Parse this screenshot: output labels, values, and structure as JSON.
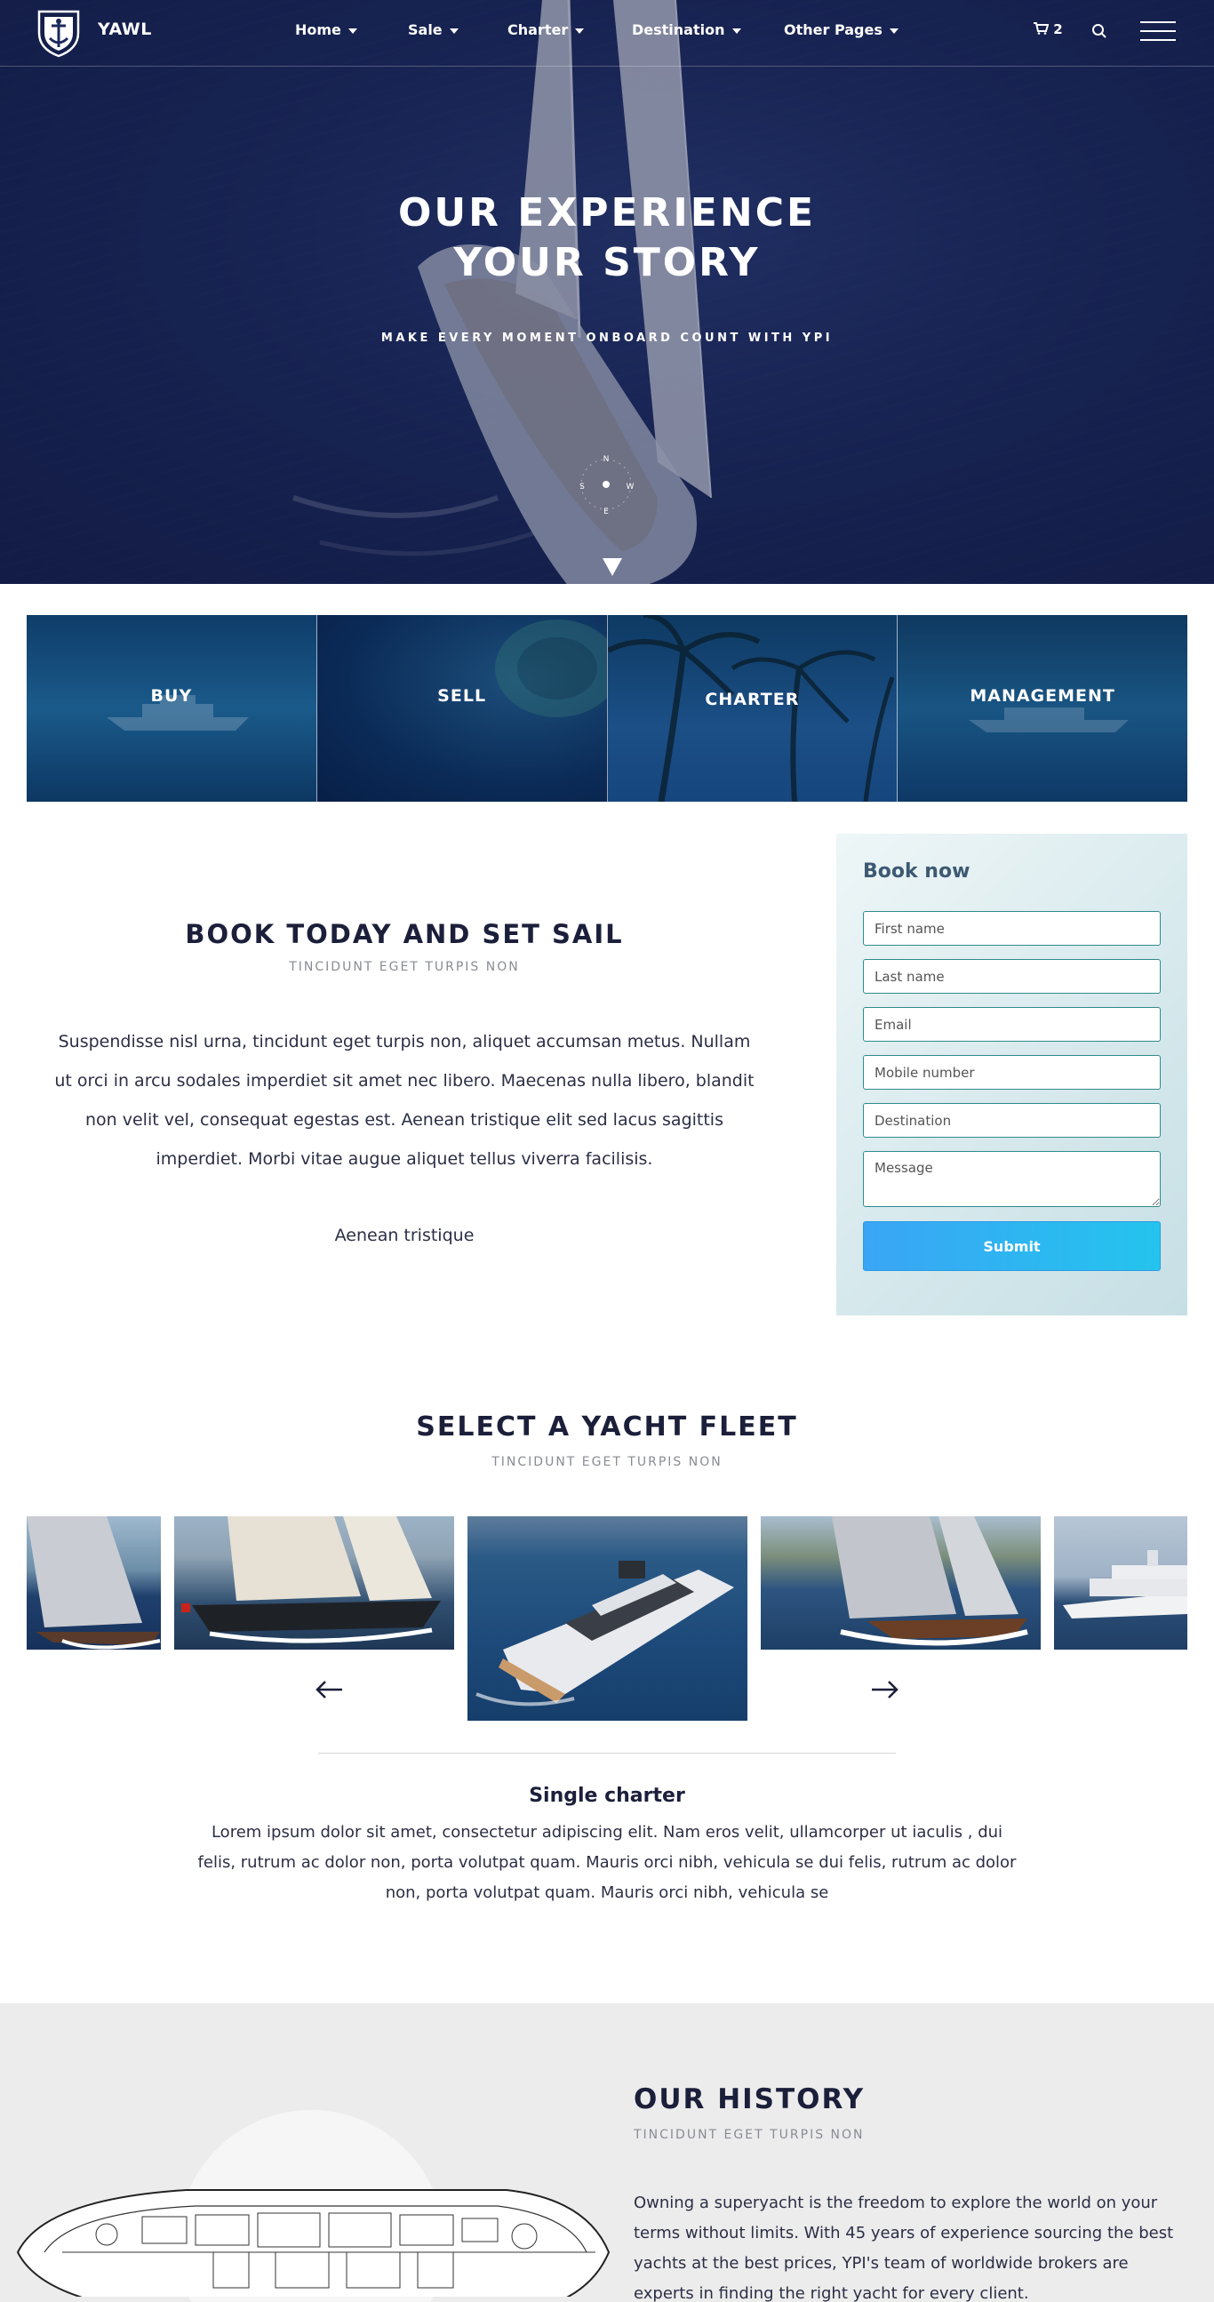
{
  "nav": {
    "brand": "YAWL",
    "items": [
      {
        "label": "Home"
      },
      {
        "label": "Sale"
      },
      {
        "label": "Charter"
      },
      {
        "label": "Destination"
      },
      {
        "label": "Other Pages"
      }
    ],
    "cart_count": "2",
    "icons": {
      "cart": "cart-icon",
      "search": "search-icon",
      "menu": "hamburger-icon",
      "logo": "shield-anchor-icon"
    }
  },
  "hero": {
    "title_line1": "OUR EXPERIENCE",
    "title_line2": "YOUR STORY",
    "subtitle": "MAKE EVERY MOMENT ONBOARD COUNT WITH YPI",
    "compass": {
      "n": "N",
      "e": "E",
      "s": "S",
      "w": "W"
    }
  },
  "tiles": [
    {
      "label": "BUY"
    },
    {
      "label": "SELL"
    },
    {
      "label": "CHARTER"
    },
    {
      "label": "MANAGEMENT"
    }
  ],
  "book": {
    "title": "BOOK TODAY AND SET SAIL",
    "subtitle": "TINCIDUNT EGET TURPIS NON",
    "body": "Suspendisse nisl urna, tincidunt eget turpis non, aliquet accumsan metus. Nullam ut orci in arcu sodales imperdiet sit amet nec libero. Maecenas nulla libero, blandit non velit vel, consequat egestas est. Aenean tristique elit sed lacus sagittis imperdiet. Morbi vitae augue aliquet tellus viverra facilisis.",
    "body2": "Aenean tristique"
  },
  "form": {
    "title": "Book now",
    "first_name": "First name",
    "last_name": "Last name",
    "email": "Email",
    "mobile": "Mobile number",
    "destination": "Destination",
    "message": "Message",
    "submit": "Submit"
  },
  "fleet": {
    "title": "SELECT A YACHT FLEET",
    "subtitle": "TINCIDUNT EGET TURPIS NON",
    "name": "Single charter",
    "description": "Lorem ipsum dolor sit amet, consectetur adipiscing elit. Nam eros velit, ullamcorper ut iaculis , dui felis, rutrum ac dolor non, porta volutpat quam. Mauris orci nibh, vehicula se dui felis, rutrum ac dolor non, porta volutpat quam. Mauris orci nibh, vehicula se"
  },
  "history": {
    "title": "OUR HISTORY",
    "subtitle": "TINCIDUNT EGET TURPIS NON",
    "body": "Owning a superyacht is the freedom to explore the world on your terms without limits. With 45 years of experience sourcing the best yachts at the best prices, YPI's team of worldwide brokers are experts in finding the right yacht for every client."
  }
}
